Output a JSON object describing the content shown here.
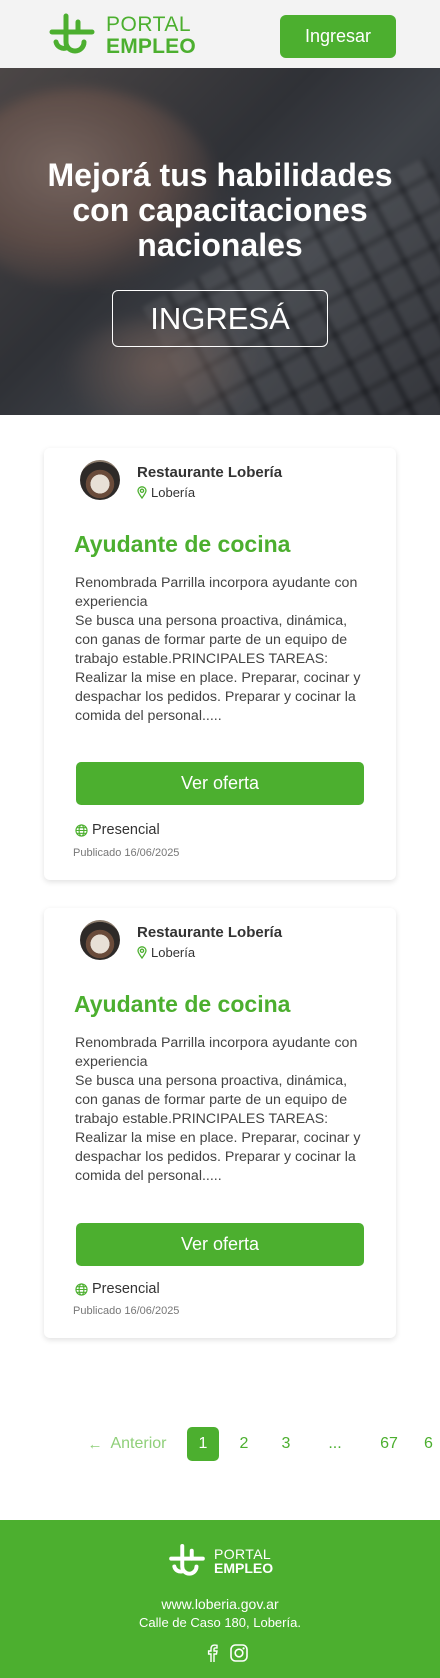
{
  "header": {
    "logo_line1": "PORTAL",
    "logo_line2": "EMPLEO",
    "login_label": "Ingresar"
  },
  "hero": {
    "title": "Mejorá tus habilidades con capacitaciones nacionales",
    "cta_label": "INGRESÁ"
  },
  "jobs": [
    {
      "company": "Restaurante Lobería",
      "location": "Lobería",
      "title": "Ayudante de cocina",
      "description": "Renombrada Parrilla incorpora ayudante con experiencia\nSe busca una persona proactiva, dinámica, con ganas de formar parte de un equipo de trabajo estable.PRINCIPALES TAREAS: Realizar la mise en place. Preparar, cocinar y despachar los pedidos. Preparar y cocinar la comida del personal.....",
      "button_label": "Ver oferta",
      "modality": "Presencial",
      "published": "Publicado 16/06/2025"
    },
    {
      "company": "Restaurante Lobería",
      "location": "Lobería",
      "title": "Ayudante de cocina",
      "description": "Renombrada Parrilla incorpora ayudante con experiencia\nSe busca una persona proactiva, dinámica, con ganas de formar parte de un equipo de trabajo estable.PRINCIPALES TAREAS: Realizar la mise en place. Preparar, cocinar y despachar los pedidos. Preparar y cocinar la comida del personal.....",
      "button_label": "Ver oferta",
      "modality": "Presencial",
      "published": "Publicado 16/06/2025"
    }
  ],
  "pagination": {
    "prev_label": "Anterior",
    "pages": [
      "1",
      "2",
      "3",
      "...",
      "67",
      "6"
    ],
    "active": "1"
  },
  "footer": {
    "logo_line1": "PORTAL",
    "logo_line2": "EMPLEO",
    "website": "www.loberia.gov.ar",
    "address": "Calle de Caso 180, Lobería."
  },
  "colors": {
    "brand_green": "#4caf2f",
    "header_bg": "#f3f3f3"
  }
}
